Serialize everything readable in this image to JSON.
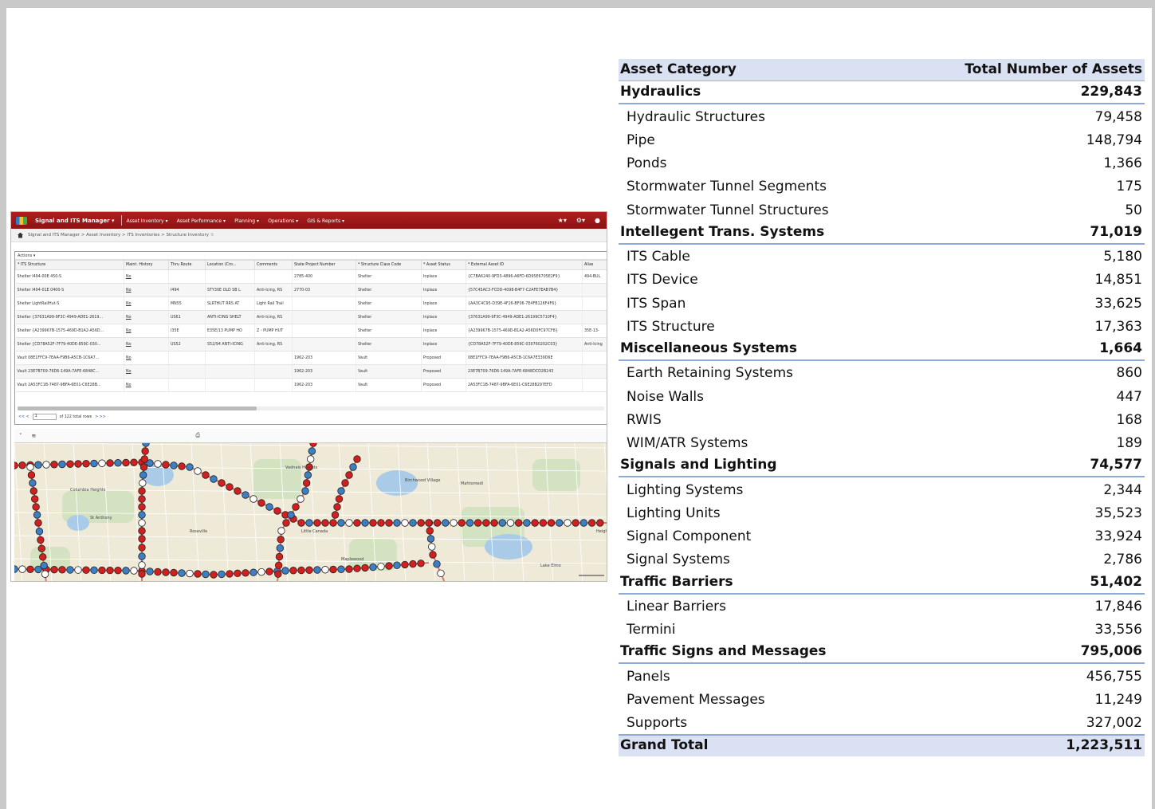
{
  "app": {
    "title": "Signal and ITS Manager ▾",
    "nav": [
      "Asset Inventory ▾",
      "Asset Performance ▾",
      "Planning ▾",
      "Operations ▾",
      "GIS & Reports ▾"
    ],
    "icons": [
      "star-icon",
      "gear-icon",
      "help-icon"
    ],
    "breadcrumb": "Signal and ITS Manager > Asset Inventory > ITS Inventories > Structure Inventory ☆",
    "actions_label": "Actions ▾",
    "columns": [
      "* ITS Structure",
      "Maint. History",
      "Thru Route",
      "Location (Cro...",
      "Comments",
      "State Project Number",
      "* Structure Class Code",
      "* Asset Status",
      "* External Asset ID",
      "Alias"
    ],
    "rows": [
      [
        "Shelter I494-00E 450-S",
        "No",
        "",
        "",
        "",
        "2785-400",
        "Shelter",
        "Inplace",
        "{C7BA6240-9FD3-4896-A6FD-6D95E6705E2F9}",
        "494-BUL"
      ],
      [
        "Shelter I494-01E 0400-S",
        "No",
        "I494",
        "STY30E OLD SB L",
        "Anti-Icing, RS",
        "2770-03",
        "Shelter",
        "Inplace",
        "{57C45AC3-FCDD-4098-B4F7-C2AFE7EAB7B4}",
        ""
      ],
      [
        "Shelter LightRailHut-S",
        "No",
        "MN55",
        "SLRTHUT RRS AT",
        "Light Rail Trail",
        "",
        "Shelter",
        "Inplace",
        "{AA3C4C95-D39E-4F26-BF06-7E4FB126F4F6}",
        ""
      ],
      [
        "Shelter {37631A99-9F3C-4949-ADE1-2619...",
        "No",
        "US61",
        "ANTI-ICING SHELT",
        "Anti-Icing, RS",
        "",
        "Shelter",
        "Inplace",
        "{37631A99-9F3C-4949-ADE1-26199C5710F4}",
        ""
      ],
      [
        "Shelter {A239967B-1575-469D-B1A2-A56D...",
        "No",
        "I35E",
        "E35E/13 PUMP HO",
        "Z - PUMP HUT",
        "",
        "Shelter",
        "Inplace",
        "{A239967B-1575-469D-B1A2-A56D0FC97CF8}",
        "35E-13-"
      ],
      [
        "Shelter {CD78A52F-7F79-40DE-859C-030...",
        "No",
        "US52",
        "S52/94 ANTI-ICING",
        "Anti-Icing, RS",
        "",
        "Shelter",
        "Inplace",
        "{CD78A52F-7F79-40DE-859C-030760202C03}",
        "Anti-Icing"
      ],
      [
        "Vault 08E1FFC9-7EAA-F9B6-A5CB-1C6A7...",
        "No",
        "",
        "",
        "",
        "1962-203",
        "Vault",
        "Proposed",
        "08E1FFC9-7EAA-F9B6-A5CB-1C6A7E339D6E",
        ""
      ],
      [
        "Vault 23E7B709-76D6-149A-7AFE-6848C...",
        "No",
        "",
        "",
        "",
        "1962-203",
        "Vault",
        "Proposed",
        "23E7B709-76D6-149A-7AFE-6848DCD2B243",
        ""
      ],
      [
        "Vault 2A53FC1B-7487-9BFA-6E01-C6E28B...",
        "No",
        "",
        "",
        "",
        "1962-203",
        "Vault",
        "Proposed",
        "2A53FC1B-7487-9BFA-6E01-C6E28B297EFD",
        ""
      ]
    ],
    "pager": {
      "prev": "<< <",
      "page": "1",
      "count": "of 122 total rows",
      "next": "> >>"
    },
    "map_labels": [
      "Vadnais Heights",
      "Birchwood Village",
      "Mahtomedi",
      "St Anthony",
      "Roseville",
      "Little Canada",
      "Maplewood",
      "Lake Elmo",
      "Columbia Heights",
      "Heights"
    ],
    "map_colors": {
      "red": "#d21f1f",
      "blue": "#3d7fc4",
      "white": "#ffffff",
      "route": "#c9302c"
    }
  },
  "assets": {
    "header": {
      "category": "Asset Category",
      "total": "Total Number of Assets"
    },
    "groups": [
      {
        "name": "Hydraulics",
        "total": "229,843",
        "items": [
          {
            "name": "Hydraulic Structures",
            "value": "79,458"
          },
          {
            "name": "Pipe",
            "value": "148,794"
          },
          {
            "name": "Ponds",
            "value": "1,366"
          },
          {
            "name": "Stormwater Tunnel Segments",
            "value": "175"
          },
          {
            "name": "Stormwater Tunnel Structures",
            "value": "50"
          }
        ]
      },
      {
        "name": "Intellegent Trans. Systems",
        "total": "71,019",
        "items": [
          {
            "name": "ITS Cable",
            "value": "5,180"
          },
          {
            "name": "ITS Device",
            "value": "14,851"
          },
          {
            "name": "ITS Span",
            "value": "33,625"
          },
          {
            "name": "ITS Structure",
            "value": "17,363"
          }
        ]
      },
      {
        "name": "Miscellaneous Systems",
        "total": "1,664",
        "items": [
          {
            "name": "Earth Retaining Systems",
            "value": "860"
          },
          {
            "name": "Noise Walls",
            "value": "447"
          },
          {
            "name": "RWIS",
            "value": "168"
          },
          {
            "name": "WIM/ATR Systems",
            "value": "189"
          }
        ]
      },
      {
        "name": "Signals and Lighting",
        "total": "74,577",
        "items": [
          {
            "name": "Lighting Systems",
            "value": "2,344"
          },
          {
            "name": "Lighting Units",
            "value": "35,523"
          },
          {
            "name": "Signal Component",
            "value": "33,924"
          },
          {
            "name": "Signal Systems",
            "value": "2,786"
          }
        ]
      },
      {
        "name": "Traffic Barriers",
        "total": "51,402",
        "items": [
          {
            "name": "Linear Barriers",
            "value": "17,846"
          },
          {
            "name": "Termini",
            "value": "33,556"
          }
        ]
      },
      {
        "name": "Traffic Signs and Messages",
        "total": "795,006",
        "items": [
          {
            "name": "Panels",
            "value": "456,755"
          },
          {
            "name": "Pavement Messages",
            "value": "11,249"
          },
          {
            "name": "Supports",
            "value": "327,002"
          }
        ]
      }
    ],
    "grand_total": {
      "label": "Grand Total",
      "value": "1,223,511"
    }
  }
}
